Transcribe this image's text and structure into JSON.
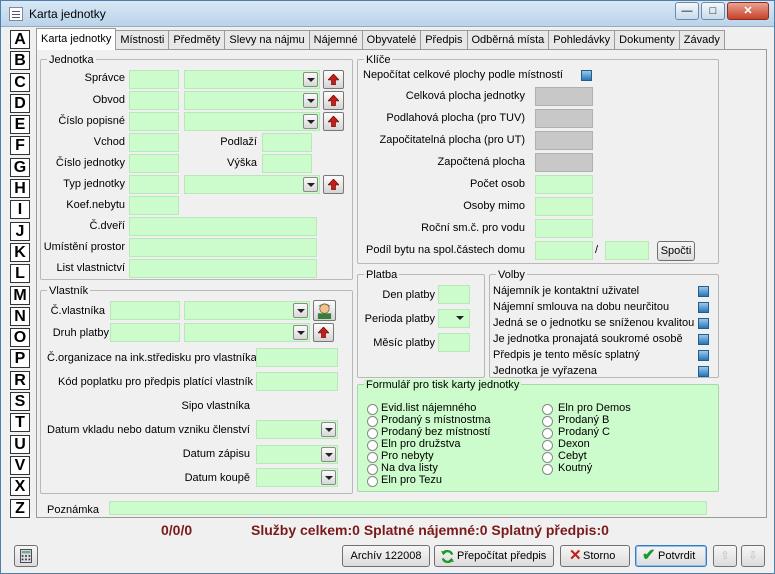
{
  "window": {
    "title": "Karta jednotky",
    "minimize": "—",
    "maximize": "□",
    "close": "✕"
  },
  "letters": [
    "A",
    "B",
    "C",
    "D",
    "E",
    "F",
    "G",
    "H",
    "I",
    "J",
    "K",
    "L",
    "M",
    "N",
    "O",
    "P",
    "R",
    "S",
    "T",
    "U",
    "V",
    "X",
    "Z"
  ],
  "tabs": [
    "Karta jednotky",
    "Místnosti",
    "Předměty",
    "Slevy na nájmu",
    "Nájemné",
    "Obyvatelé",
    "Předpis",
    "Odběrná místa",
    "Pohledávky",
    "Dokumenty",
    "Závady"
  ],
  "jednotka": {
    "title": "Jednotka",
    "spravce": "Správce",
    "obvod": "Obvod",
    "cislo_popisne": "Číslo popisné",
    "vchod": "Vchod",
    "podlazi": "Podlaží",
    "cislo_jednotky": "Číslo jednotky",
    "vyska": "Výška",
    "typ_jednotky": "Typ jednotky",
    "koef_nebytu": "Koef.nebytu",
    "c_dveri": "Č.dveří",
    "umisteni": "Umístění prostor",
    "list_vlastnictvi": "List vlastnictví"
  },
  "klice": {
    "title": "Klíče",
    "nepocitat": "Nepočítat celkové plochy podle místností",
    "celkova": "Celková plocha jednotky",
    "podlahova": "Podlahová plocha (pro TUV)",
    "zapocitatelna": "Započitatelná plocha (pro UT)",
    "zapoctena": "Započtená plocha",
    "pocet_osob": "Počet osob",
    "osoby_mimo": "Osoby mimo",
    "rocni": "Roční sm.č. pro vodu",
    "podil": "Podíl bytu na spol.částech domu",
    "slash": "/",
    "spocti": "Spočti"
  },
  "vlastnik": {
    "title": "Vlastník",
    "c_vlastnika": "Č.vlastníka",
    "druh_platby": "Druh platby",
    "c_organizace": "Č.organizace na ink.středisku pro vlastníka",
    "kod_poplatku": "Kód poplatku pro předpis platící vlastník",
    "sipo": "Sipo vlastníka",
    "datum_vkladu": "Datum vkladu nebo datum vzniku členství",
    "datum_zapisu": "Datum zápisu",
    "datum_koupe": "Datum koupě"
  },
  "platba": {
    "title": "Platba",
    "den": "Den platby",
    "perioda": "Perioda platby",
    "mesic": "Měsíc platby"
  },
  "volby": {
    "title": "Volby",
    "items": [
      "Nájemník je kontaktní uživatel",
      "Nájemní smlouva na dobu neurčitou",
      "Jedná se o jednotku se sníženou kvalitou",
      "Je jednotka pronajatá soukromé osobě",
      "Předpis je tento měsíc splatný",
      "Jednotka je vyřazena"
    ]
  },
  "formular": {
    "title": "Formulář pro tisk karty jednotky",
    "left": [
      "Evid.list nájemného",
      "Prodaný s místnostma",
      "Prodaný bez místností",
      "Eln pro družstva",
      "Pro nebyty",
      "Na dva listy",
      "Eln pro Tezu"
    ],
    "right": [
      "Eln pro Demos",
      "Prodaný B",
      "Prodaný C",
      "Dexon",
      "Cebyt",
      "Koutný"
    ]
  },
  "poznamka": "Poznámka",
  "status": {
    "counts": "0/0/0",
    "summary": "Služby celkem:0 Splatné nájemné:0 Splatný předpis:0"
  },
  "buttons": {
    "archiv": "Archív 122008",
    "prepocitat": "Přepočítat předpis",
    "storno": "Storno",
    "potvrdit": "Potvrdit"
  }
}
